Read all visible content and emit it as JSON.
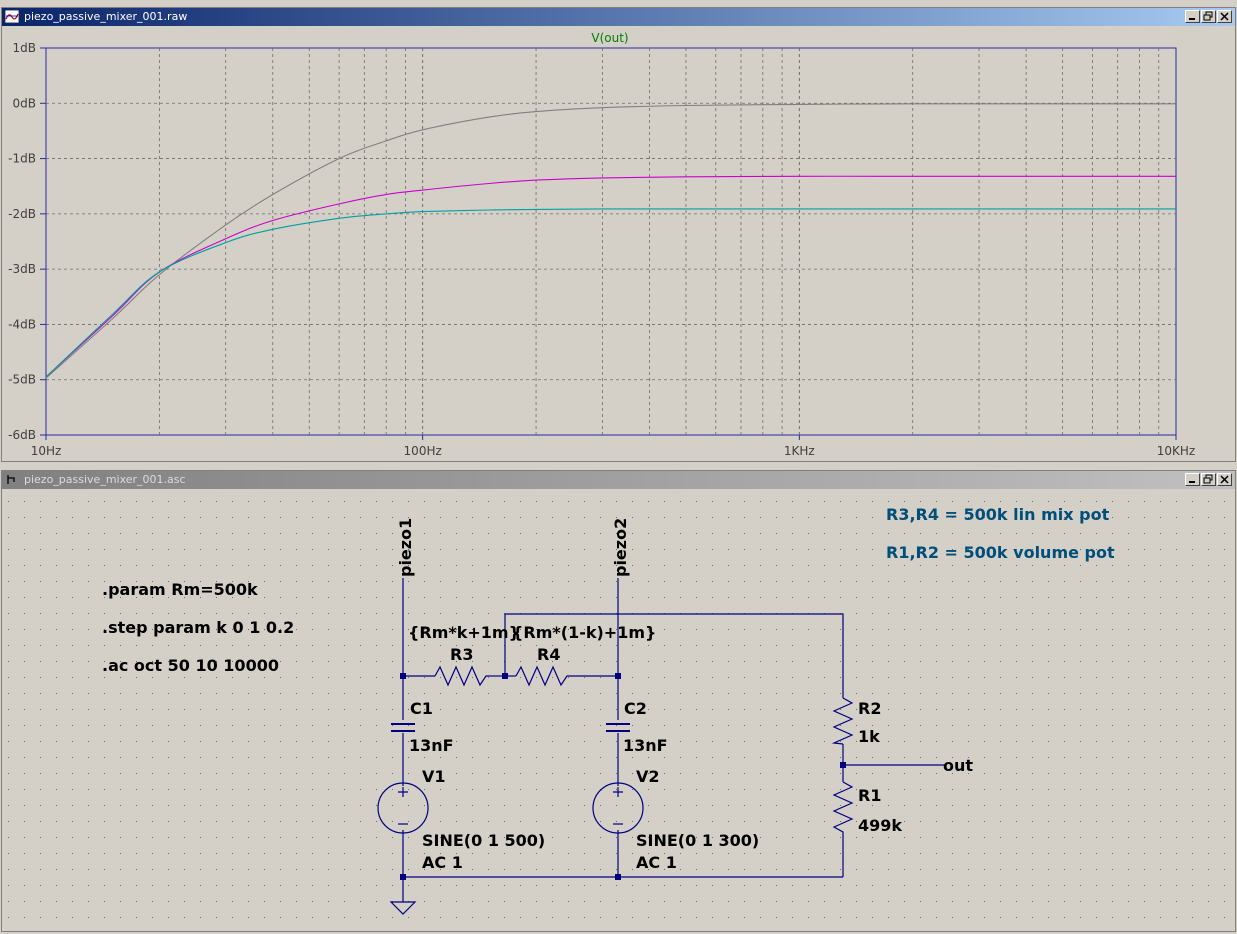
{
  "plot_window": {
    "title": "piezo_passive_mixer_001.raw",
    "trace_label": "V(out)"
  },
  "chart_data": {
    "type": "line",
    "title": "V(out)",
    "xscale": "log",
    "xlim": [
      10,
      10000
    ],
    "ylim": [
      -6,
      1
    ],
    "x_tick_labels": [
      "10Hz",
      "100Hz",
      "1KHz",
      "10KHz"
    ],
    "y_tick_labels": [
      "1dB",
      "0dB",
      "-1dB",
      "-2dB",
      "-3dB",
      "-4dB",
      "-5dB",
      "-6dB"
    ],
    "grid": true,
    "series": [
      {
        "color": "#808080",
        "x": [
          10,
          15,
          20,
          30,
          40,
          60,
          80,
          100,
          150,
          200,
          300,
          500,
          1000,
          2000,
          5000,
          10000
        ],
        "y": [
          -4.97,
          -3.9,
          -3.1,
          -2.2,
          -1.65,
          -1.0,
          -0.68,
          -0.48,
          -0.25,
          -0.15,
          -0.08,
          -0.04,
          -0.02,
          -0.01,
          -0.01,
          -0.01
        ]
      },
      {
        "color": "#cc00cc",
        "x": [
          10,
          15,
          20,
          30,
          40,
          60,
          80,
          100,
          150,
          200,
          300,
          500,
          1000,
          2000,
          5000,
          10000
        ],
        "y": [
          -4.95,
          -3.85,
          -3.05,
          -2.45,
          -2.12,
          -1.82,
          -1.65,
          -1.57,
          -1.45,
          -1.39,
          -1.35,
          -1.33,
          -1.32,
          -1.32,
          -1.32,
          -1.32
        ]
      },
      {
        "color": "#00a0a0",
        "x": [
          10,
          15,
          20,
          30,
          40,
          60,
          80,
          100,
          150,
          200,
          300,
          500,
          1000,
          2000,
          5000,
          10000
        ],
        "y": [
          -4.95,
          -3.82,
          -3.05,
          -2.52,
          -2.28,
          -2.08,
          -2.0,
          -1.96,
          -1.93,
          -1.92,
          -1.91,
          -1.91,
          -1.91,
          -1.91,
          -1.91,
          -1.91
        ]
      }
    ]
  },
  "schematic_window": {
    "title": "piezo_passive_mixer_001.asc",
    "directives": [
      ".param Rm=500k",
      ".step param k 0 1 0.2",
      ".ac oct 50 10 10000"
    ],
    "notes": [
      "R3,R4 = 500k lin mix pot",
      "R1,R2 = 500k volume pot"
    ],
    "net_labels": {
      "piezo1": "piezo1",
      "piezo2": "piezo2",
      "out": "out"
    },
    "components": {
      "R3": {
        "name": "R3",
        "value": "{Rm*k+1m}"
      },
      "R4": {
        "name": "R4",
        "value": "{Rm*(1-k)+1m}"
      },
      "C1": {
        "name": "C1",
        "value": "13nF"
      },
      "C2": {
        "name": "C2",
        "value": "13nF"
      },
      "V1": {
        "name": "V1",
        "value": "SINE(0 1 500)",
        "ac": "AC 1"
      },
      "V2": {
        "name": "V2",
        "value": "SINE(0 1 300)",
        "ac": "AC 1"
      },
      "R2": {
        "name": "R2",
        "value": "1k"
      },
      "R1": {
        "name": "R1",
        "value": "499k"
      }
    },
    "colors": {
      "wire": "#000080",
      "note": "#004e7a",
      "grid_dot": "#6b6b6b"
    }
  }
}
